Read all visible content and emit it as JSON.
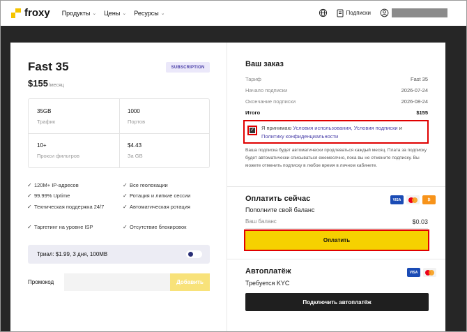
{
  "header": {
    "logo_text": "froxy",
    "nav": [
      {
        "label": "Продукты"
      },
      {
        "label": "Цены"
      },
      {
        "label": "Ресурсы"
      }
    ],
    "subscriptions_label": "Подписки"
  },
  "plan": {
    "name": "Fast 35",
    "badge": "SUBSCRIPTION",
    "price": "$155",
    "per": "/месяц",
    "stats": [
      {
        "value": "35GB",
        "label": "Трафик"
      },
      {
        "value": "1000",
        "label": "Портов"
      },
      {
        "value": "10+",
        "label": "Прокси фильтров"
      },
      {
        "value": "$4.43",
        "label": "За GB"
      }
    ],
    "features": [
      "120M+ IP-адресов",
      "Все геолокации",
      "99.99% Uptime",
      "Ротация и липкие сессии",
      "Техническая поддержка 24/7",
      "Автоматическая ротация",
      "Таргетинг на уровне ISP",
      "Отсутствие блокировок"
    ],
    "trial": "Триал: $1.99, 3 дня, 100MB",
    "promo_label": "Промокод",
    "promo_value": "",
    "promo_button": "Добавить"
  },
  "order": {
    "title": "Ваш заказ",
    "rows": [
      {
        "label": "Тариф",
        "value": "Fast 35"
      },
      {
        "label": "Начало подписки",
        "value": "2026-07-24"
      },
      {
        "label": "Окончание подписки",
        "value": "2026-08-24"
      },
      {
        "label": "Итого",
        "value": "$155"
      }
    ],
    "agree_prefix": "Я принимаю ",
    "agree_link1": "Условия использования, Условия подписки",
    "agree_mid": " и ",
    "agree_link2": "Политику конфиденциальности",
    "note": "Ваша подписка будет автоматически продлеваться каждый месяц. Плата за подписку будет автоматически списываться ежемесячно, пока вы не отмените подписку. Вы можете отменить подписку в любое время в личном кабинете.",
    "pay_title": "Оплатить сейчас",
    "refill": "Пополните свой баланс",
    "balance_label": "Ваш баланс",
    "balance_value": "$0.03",
    "pay_button": "Оплатить",
    "auto_title": "Автоплатёж",
    "kyc": "Требуется KYC",
    "auto_button": "Подключить автоплатёж",
    "card_visa": "VISA"
  },
  "colors": {
    "accent": "#f6d100",
    "link": "#4a3fa8",
    "highlight": "#e00000"
  }
}
